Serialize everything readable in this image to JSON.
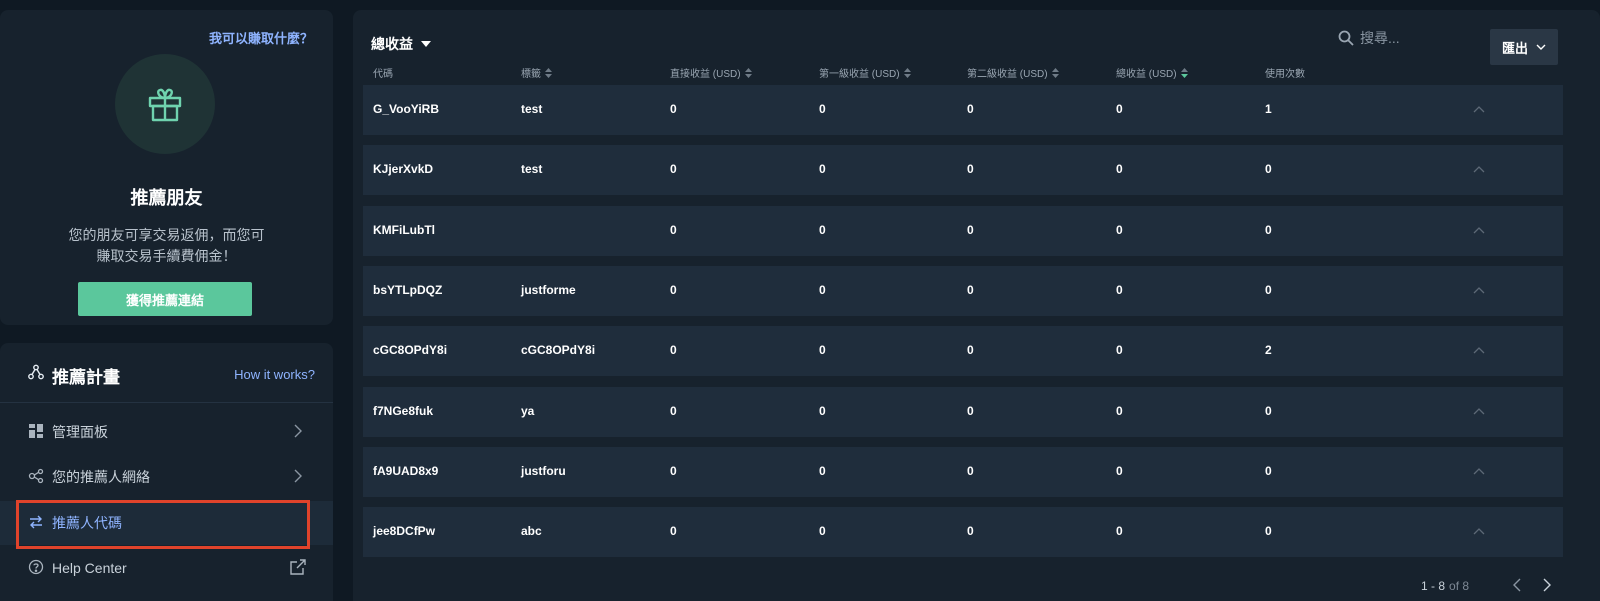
{
  "promo": {
    "earn_link": "我可以賺取什麼？",
    "title": "推薦朋友",
    "desc_line1": "您的朋友可享交易返佣，而您可",
    "desc_line2": "賺取交易手續費佣金！",
    "cta": "獲得推薦連結"
  },
  "nav": {
    "title": "推薦計畫",
    "how": "How it works?",
    "items": [
      {
        "label": "管理面板",
        "icon": "dashboard-icon"
      },
      {
        "label": "您的推薦人網絡",
        "icon": "network-icon"
      },
      {
        "label": "推薦人代碼",
        "icon": "swap-icon"
      },
      {
        "label": "Help Center",
        "icon": "help-icon"
      }
    ]
  },
  "main": {
    "filter_label": "總收益",
    "search_placeholder": "搜尋...",
    "export_label": "匯出",
    "headers": [
      "代碼",
      "標籤",
      "直接收益 (USD)",
      "第一級收益 (USD)",
      "第二級收益 (USD)",
      "總收益 (USD)",
      "使用次數"
    ],
    "rows": [
      [
        "G_VooYiRB",
        "test",
        "0",
        "0",
        "0",
        "0",
        "1"
      ],
      [
        "KJjerXvkD",
        "test",
        "0",
        "0",
        "0",
        "0",
        "0"
      ],
      [
        "KMFiLubTl",
        "",
        "0",
        "0",
        "0",
        "0",
        "0"
      ],
      [
        "bsYTLpDQZ",
        "justforme",
        "0",
        "0",
        "0",
        "0",
        "0"
      ],
      [
        "cGC8OPdY8i",
        "cGC8OPdY8i",
        "0",
        "0",
        "0",
        "0",
        "2"
      ],
      [
        "f7NGe8fuk",
        "ya",
        "0",
        "0",
        "0",
        "0",
        "0"
      ],
      [
        "fA9UAD8x9",
        "justforu",
        "0",
        "0",
        "0",
        "0",
        "0"
      ],
      [
        "jee8DCfPw",
        "abc",
        "0",
        "0",
        "0",
        "0",
        "0"
      ]
    ],
    "pager_range": "1 - 8",
    "pager_of": "of 8"
  },
  "colors": {
    "accent": "#5bc79c",
    "link": "#8fb4ff",
    "highlight": "#e0432b"
  }
}
